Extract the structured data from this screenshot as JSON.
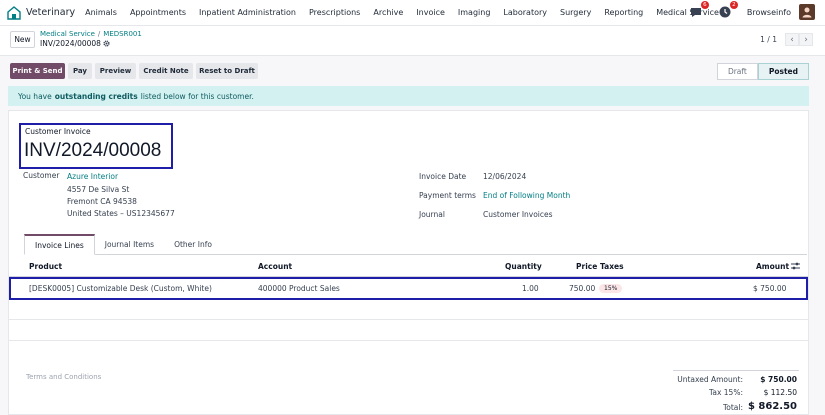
{
  "nav": {
    "app_name": "Veterinary",
    "menu": [
      "Animals",
      "Appointments",
      "Inpatient Administration",
      "Prescriptions",
      "Archive",
      "Invoice",
      "Imaging",
      "Laboratory",
      "Surgery",
      "Reporting",
      "Medical Service"
    ],
    "messages_count": "6",
    "activities_count": "2",
    "company": "Browseinfo"
  },
  "control": {
    "new_label": "New",
    "breadcrumb": [
      "Medical Service",
      "MEDSR001"
    ],
    "record_name": "INV/2024/00008",
    "pager": "1 / 1"
  },
  "actions": {
    "print_send": "Print & Send",
    "pay": "Pay",
    "preview": "Preview",
    "credit_note": "Credit Note",
    "reset_draft": "Reset to Draft"
  },
  "status": {
    "draft": "Draft",
    "posted": "Posted",
    "active": "posted"
  },
  "alert": {
    "prefix": "You have",
    "bold": "outstanding credits",
    "suffix": "listed below for this customer."
  },
  "invoice": {
    "type_label": "Customer Invoice",
    "number": "INV/2024/00008",
    "customer_label": "Customer",
    "customer_name": "Azure Interior",
    "address": [
      "4557 De Silva St",
      "Fremont CA 94538",
      "United States – US12345677"
    ],
    "invoice_date_label": "Invoice Date",
    "invoice_date": "12/06/2024",
    "payment_terms_label": "Payment terms",
    "payment_terms": "End of Following Month",
    "journal_label": "Journal",
    "journal": "Customer Invoices"
  },
  "tabs": [
    "Invoice Lines",
    "Journal Items",
    "Other Info"
  ],
  "table": {
    "headers": {
      "product": "Product",
      "account": "Account",
      "quantity": "Quantity",
      "price": "Price",
      "taxes": "Taxes",
      "amount": "Amount"
    },
    "rows": [
      {
        "product": "[DESK0005] Customizable Desk (Custom, White)",
        "account": "400000 Product Sales",
        "quantity": "1.00",
        "price": "750.00",
        "tax": "15%",
        "amount": "$ 750.00"
      }
    ]
  },
  "terms_placeholder": "Terms and Conditions",
  "totals": {
    "untaxed_label": "Untaxed Amount:",
    "untaxed": "$ 750.00",
    "tax_label": "Tax 15%:",
    "tax": "$ 112.50",
    "total_label": "Total:",
    "total": "$ 862.50"
  },
  "colors": {
    "brand": "#714b67",
    "link": "#017e84",
    "highlight_box": "#1e1ea8"
  }
}
